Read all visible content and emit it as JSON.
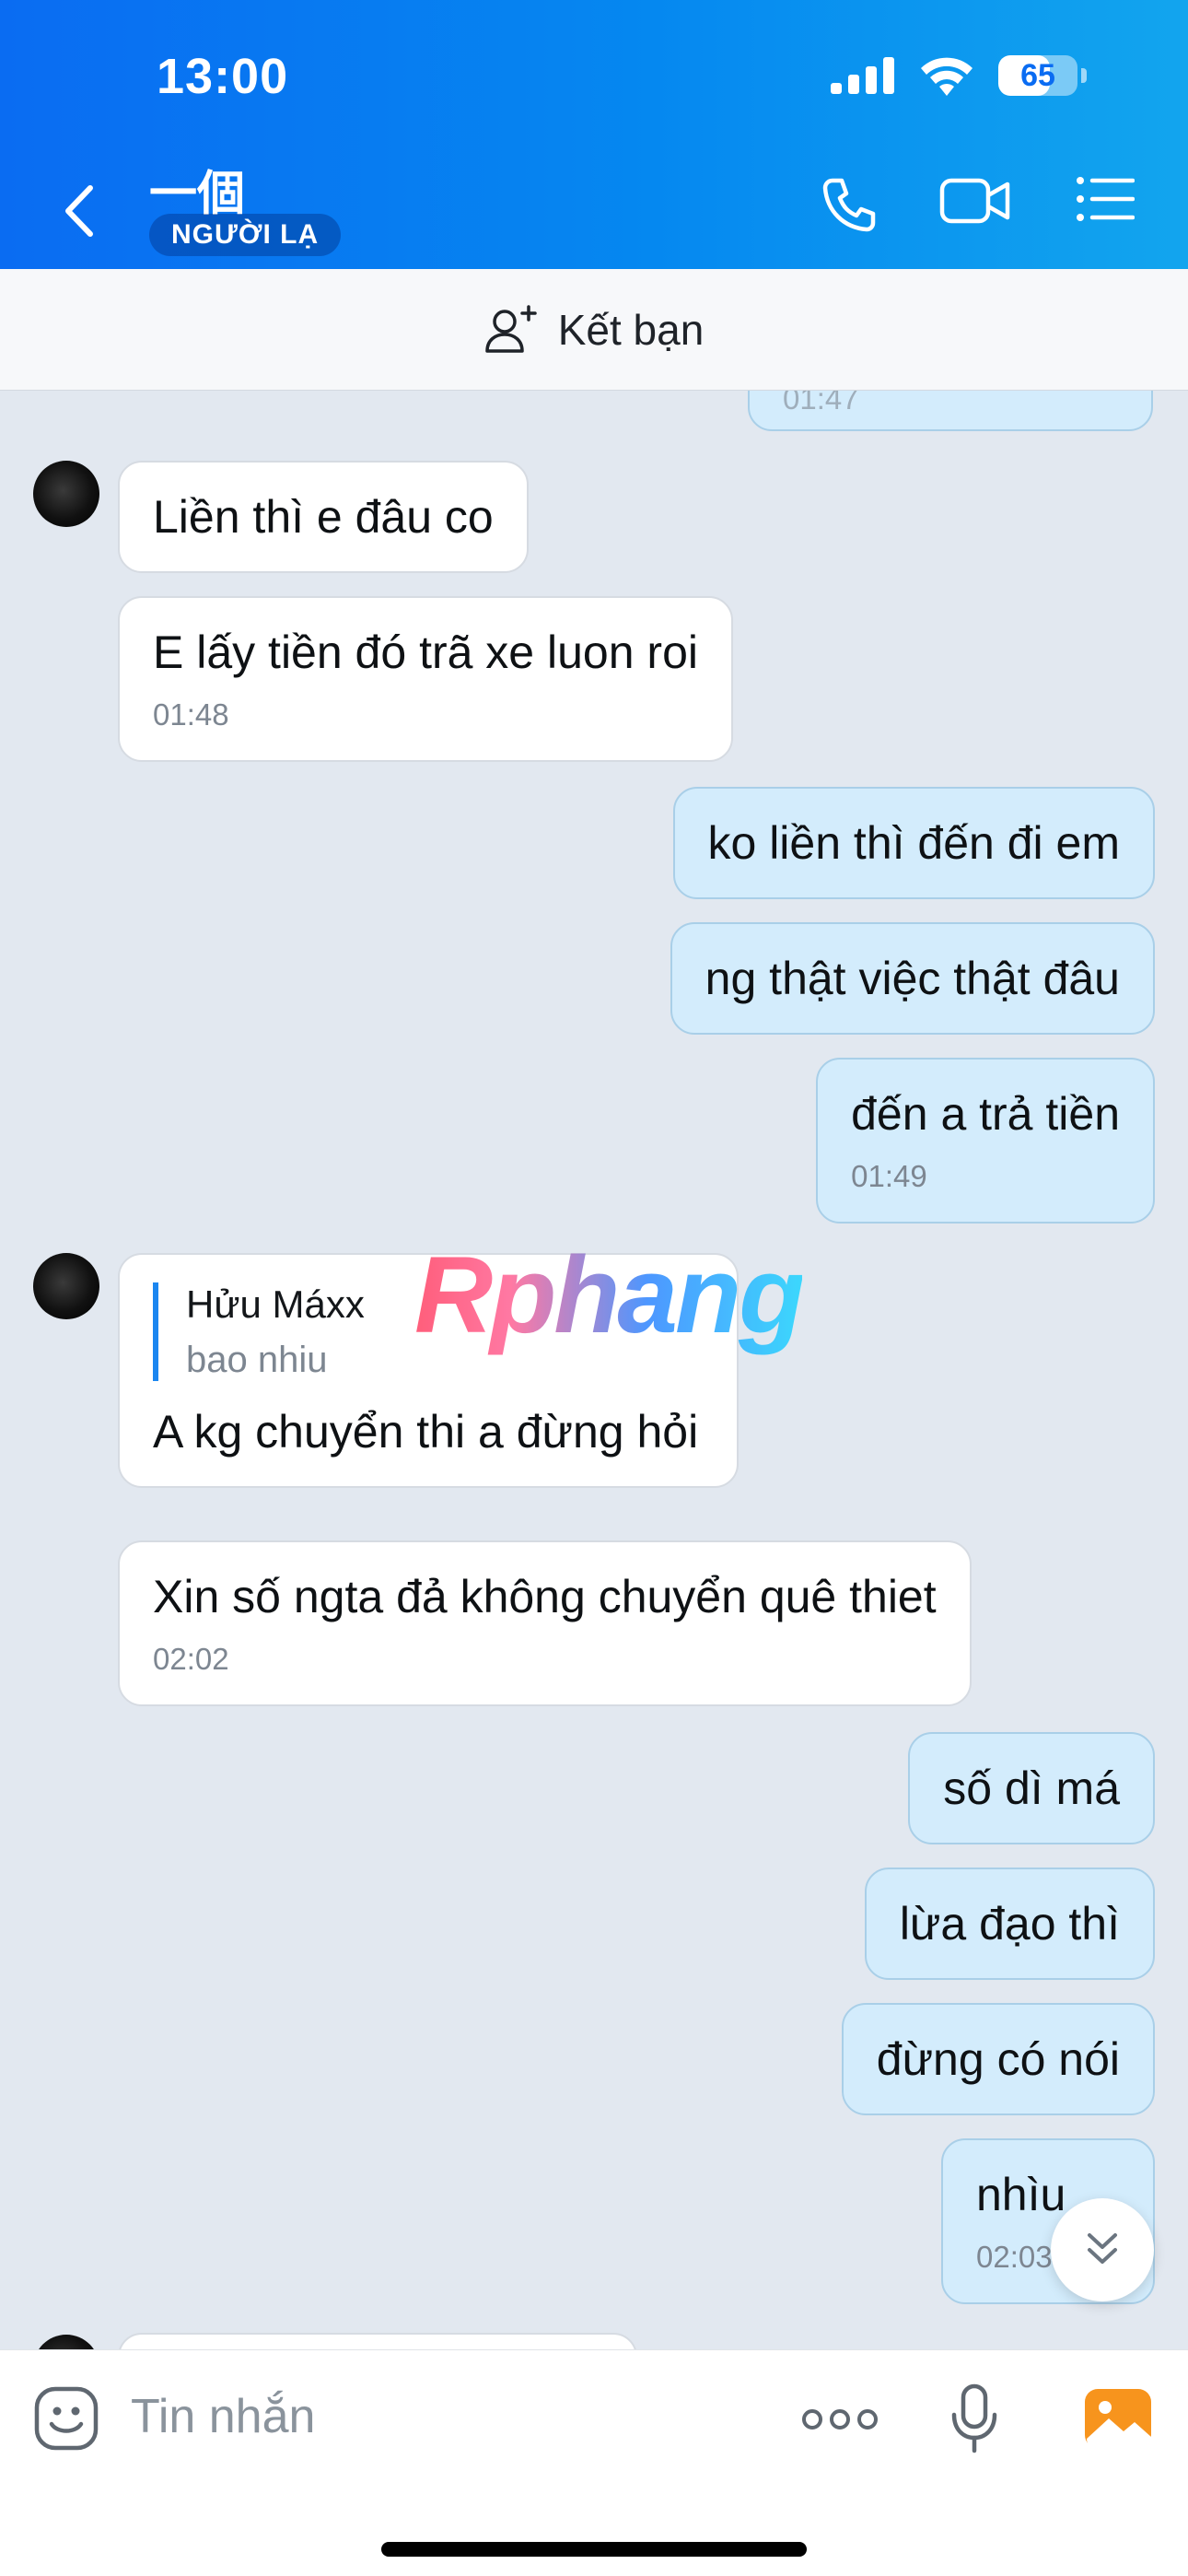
{
  "status_bar": {
    "time": "13:00",
    "battery": "65",
    "battery_level": 0.65
  },
  "header": {
    "title": "一個",
    "badge": "NGƯỜI LẠ"
  },
  "friend_bar": {
    "label": "Kết bạn"
  },
  "messages": {
    "m0_time": "01:47",
    "m1": "Liền thì e đâu co",
    "m2": "E lấy tiền đó trã xe luon roi",
    "m2_time": "01:48",
    "m3": "ko liền thì đến đi em",
    "m4": "ng thật việc thật đâu",
    "m5": "đến a trả tiền",
    "m5_time": "01:49",
    "m6_quote_name": "Hửu Máxx",
    "m6_quote_text": "bao nhiu",
    "m6": "A kg chuyển thi a đừng hỏi",
    "m7": "Xin số ngta đả không chuyển quê thiet",
    "m7_time": "02:02",
    "m8": "số dì má",
    "m9": "lừa đạo thì",
    "m10": "đừng có nói",
    "m11": "nhìu",
    "m11_time": "02:03"
  },
  "watermark": "Rphang",
  "input": {
    "placeholder": "Tin nhắn"
  },
  "icons": {
    "back": "chevron-left-icon",
    "call": "phone-icon",
    "video": "video-camera-icon",
    "menu": "list-menu-icon",
    "add_friend": "add-user-icon",
    "emoji": "sticker-icon",
    "more": "more-dots-icon",
    "mic": "microphone-icon",
    "image": "image-icon",
    "scroll": "double-chevron-down-icon"
  },
  "colors": {
    "header_start": "#0a6cf2",
    "header_end": "#12a5ee",
    "outgoing_bubble": "#d3ecfc",
    "incoming_bubble": "#ffffff",
    "image_icon": "#f7941d"
  }
}
